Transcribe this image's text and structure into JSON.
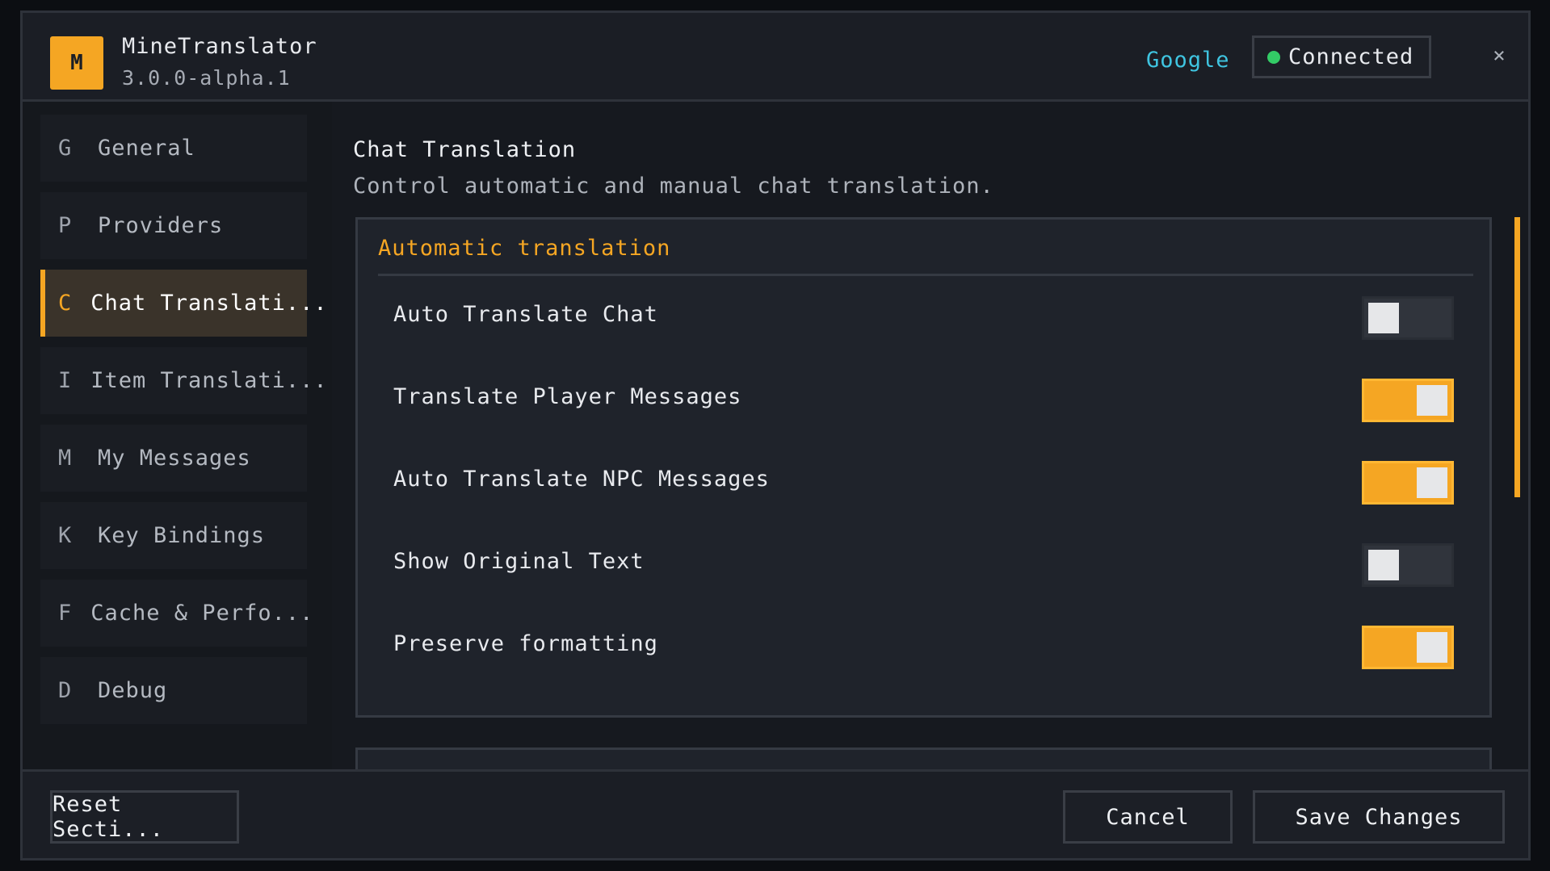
{
  "header": {
    "logo_letter": "M",
    "app_title": "MineTranslator",
    "app_version": "3.0.0-alpha.1",
    "provider": "Google",
    "status": "Connected",
    "close": "×"
  },
  "sidebar": {
    "items": [
      {
        "letter": "G",
        "label": "General",
        "active": false
      },
      {
        "letter": "P",
        "label": "Providers",
        "active": false
      },
      {
        "letter": "C",
        "label": "Chat Translati...",
        "active": true
      },
      {
        "letter": "I",
        "label": "Item Translati...",
        "active": false
      },
      {
        "letter": "M",
        "label": "My Messages",
        "active": false
      },
      {
        "letter": "K",
        "label": "Key Bindings",
        "active": false
      },
      {
        "letter": "F",
        "label": "Cache & Perfo...",
        "active": false
      },
      {
        "letter": "D",
        "label": "Debug",
        "active": false
      }
    ]
  },
  "main": {
    "title": "Chat Translation",
    "description": "Control automatic and manual chat translation.",
    "card": {
      "title": "Automatic translation",
      "settings": [
        {
          "label": "Auto Translate Chat",
          "enabled": false
        },
        {
          "label": "Translate Player Messages",
          "enabled": true
        },
        {
          "label": "Auto Translate NPC Messages",
          "enabled": true
        },
        {
          "label": "Show Original Text",
          "enabled": false
        },
        {
          "label": "Preserve formatting",
          "enabled": true
        }
      ]
    }
  },
  "footer": {
    "reset_label": "Reset Secti...",
    "cancel_label": "Cancel",
    "save_label": "Save Changes"
  },
  "colors": {
    "accent": "#f5a623",
    "status_online": "#33cc66",
    "link": "#3fc4e0"
  }
}
